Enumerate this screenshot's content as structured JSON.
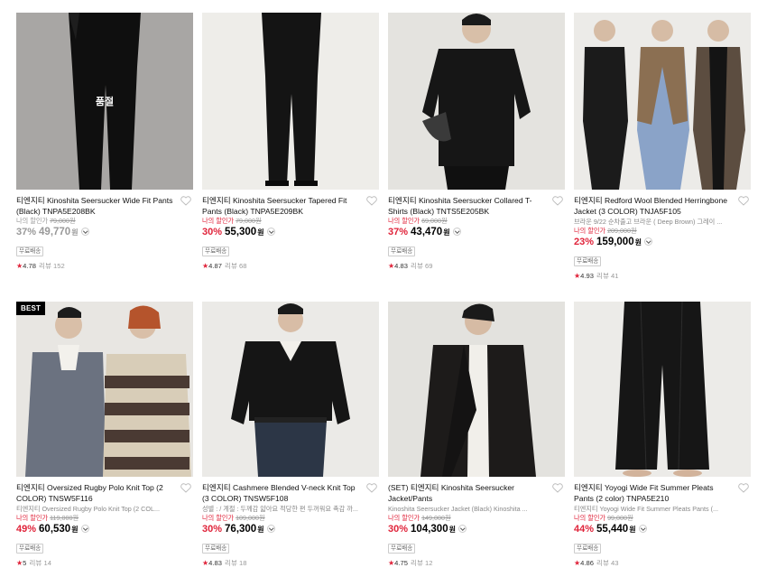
{
  "products": [
    {
      "title": "티엔지티 Kinoshita Seersucker Wide Fit Pants (Black) TNPA5E208BK",
      "subtitle": "",
      "my_price_label": "나의 할인가",
      "original_price": "79,000원",
      "discount": "37%",
      "price": "49,770",
      "currency": "원",
      "badge": "무료배송",
      "rating": "4.78",
      "reviews": "리뷰 152",
      "overlay": "품절",
      "sold_out": true
    },
    {
      "title": "티엔지티 Kinoshita Seersucker Tapered Fit Pants (Black) TNPA5E209BK",
      "subtitle": "",
      "my_price_label": "나의 할인가",
      "original_price": "79,000원",
      "discount": "30%",
      "price": "55,300",
      "currency": "원",
      "badge": "무료배송",
      "rating": "4.87",
      "reviews": "리뷰 68"
    },
    {
      "title": "티엔지티 Kinoshita Seersucker Collared T-Shirts (Black) TNTS5E205BK",
      "subtitle": "",
      "my_price_label": "나의 할인가",
      "original_price": "69,000원",
      "discount": "37%",
      "price": "43,470",
      "currency": "원",
      "badge": "무료배송",
      "rating": "4.83",
      "reviews": "리뷰 69"
    },
    {
      "title": "티엔지티 Redford Wool Blended Herringbone Jacket (3 COLOR) TNJA5F105",
      "subtitle": "브라운 9/22 순차출고 브라운 ( Deep Brown) 그레이 ...",
      "my_price_label": "나의 할인가",
      "original_price": "209,000원",
      "discount": "23%",
      "price": "159,000",
      "currency": "원",
      "badge": "무료배송",
      "rating": "4.93",
      "reviews": "리뷰 41"
    },
    {
      "title": "티엔지티 Oversized Rugby Polo Knit Top (2 COLOR) TNSW5F116",
      "subtitle": "티엔지티 Oversized Rugby Polo Knit Top (2 COL...",
      "my_price_label": "나의 할인가",
      "original_price": "119,000원",
      "discount": "49%",
      "price": "60,530",
      "currency": "원",
      "badge": "무료배송",
      "rating": "5",
      "reviews": "리뷰 14",
      "tag": "BEST"
    },
    {
      "title": "티엔지티 Cashmere Blended V-neck Knit Top (3 COLOR) TNSW5F108",
      "subtitle": "성별 : / 계절 : 두께감 얇아요 적당한 편 두꺼워요 촉감 까...",
      "my_price_label": "나의 할인가",
      "original_price": "109,000원",
      "discount": "30%",
      "price": "76,300",
      "currency": "원",
      "badge": "무료배송",
      "rating": "4.83",
      "reviews": "리뷰 18"
    },
    {
      "title": "(SET) 티엔지티 Kinoshita Seersucker Jacket/Pants",
      "subtitle": "Kinoshita Seersucker Jacket (Black) Kinoshita ...",
      "my_price_label": "나의 할인가",
      "original_price": "149,000원",
      "discount": "30%",
      "price": "104,300",
      "currency": "원",
      "badge": "무료배송",
      "rating": "4.75",
      "reviews": "리뷰 12"
    },
    {
      "title": "티엔지티 Yoyogi Wide Fit Summer Pleats Pants (2 color) TNPA5E210",
      "subtitle": "티엔지티 Yoyogi Wide Fit Summer Pleats Pants (...",
      "my_price_label": "나의 할인가",
      "original_price": "99,000원",
      "discount": "44%",
      "price": "55,440",
      "currency": "원",
      "badge": "무료배송",
      "rating": "4.86",
      "reviews": "리뷰 43"
    }
  ],
  "icons": {
    "heart": "heart-outline-icon",
    "star": "star-icon",
    "chevron": "chevron-down-icon"
  },
  "colors": {
    "accent_red": "#e0233a",
    "muted_gray": "#999999"
  }
}
